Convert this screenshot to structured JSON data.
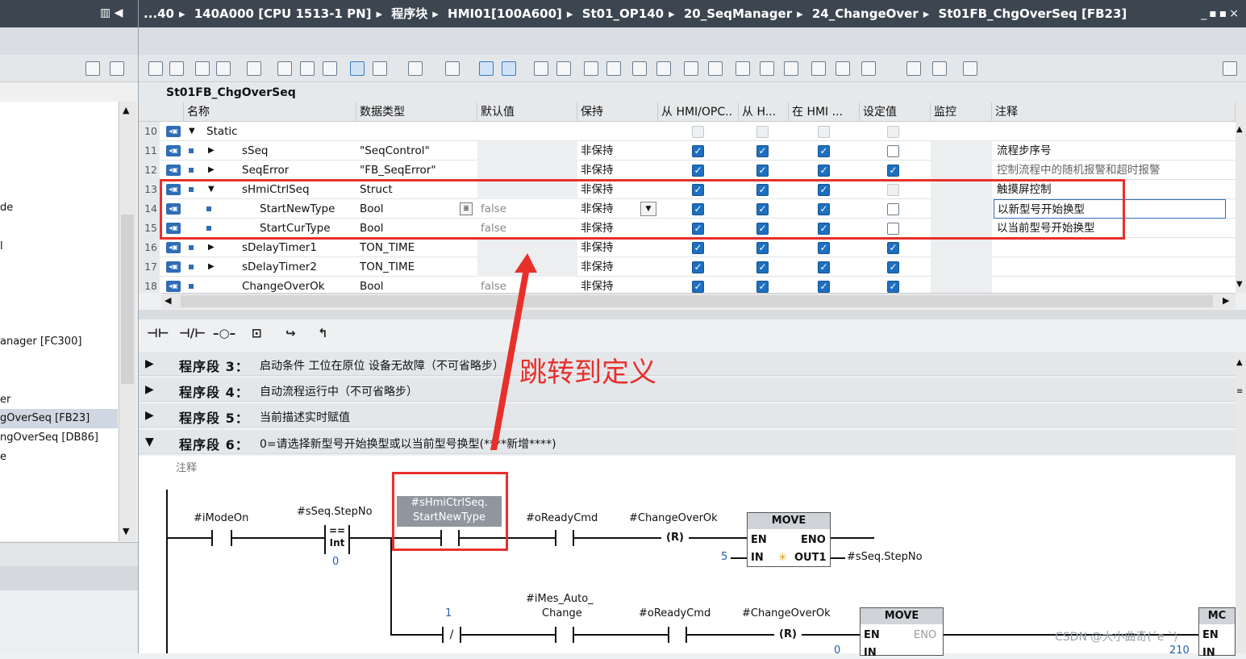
{
  "breadcrumb": [
    "...40",
    "140A000 [CPU 1513-1 PN]",
    "程序块",
    "HMI01[100A600]",
    "St01_OP140",
    "20_SeqManager",
    "24_ChangeOver",
    "St01FB_ChgOverSeq [FB23]"
  ],
  "window_controls": "_▪▪×",
  "block_title": "St01FB_ChgOverSeq",
  "left_tree": [
    {
      "text": "de"
    },
    {
      "text": "l"
    },
    {
      "text": "anager [FC300]"
    },
    {
      "text": "er"
    },
    {
      "text": "gOverSeq [FB23]"
    },
    {
      "text": "ngOverSeq [DB86]"
    },
    {
      "text": "e"
    }
  ],
  "columns": [
    "名称",
    "数据类型",
    "默认值",
    "保持",
    "从 HMI/OPC..",
    "从 H...",
    "在 HMI ...",
    "设定值",
    "监控",
    "注释"
  ],
  "rows": [
    {
      "n": "10",
      "name": "Static",
      "type": "",
      "def": "",
      "ret": "",
      "c": [
        0,
        0,
        0,
        0
      ],
      "comment": "",
      "static": true
    },
    {
      "n": "11",
      "name": "sSeq",
      "type": "\"SeqControl\"",
      "def": "",
      "ret": "非保持",
      "c": [
        1,
        1,
        1,
        0
      ],
      "comment": "流程步序号"
    },
    {
      "n": "12",
      "name": "SeqError",
      "type": "\"FB_SeqError\"",
      "def": "",
      "ret": "非保持",
      "c": [
        1,
        1,
        1,
        1
      ],
      "comment": "控制流程中的随机报警和超时报警"
    },
    {
      "n": "13",
      "name": "sHmiCtrlSeq",
      "type": "Struct",
      "def": "",
      "ret": "非保持",
      "c": [
        1,
        1,
        1,
        0
      ],
      "comment": "触摸屏控制"
    },
    {
      "n": "14",
      "name": "StartNewType",
      "type": "Bool",
      "def": "false",
      "ret": "非保持",
      "c": [
        1,
        1,
        1,
        0
      ],
      "comment": "以新型号开始换型"
    },
    {
      "n": "15",
      "name": "StartCurType",
      "type": "Bool",
      "def": "false",
      "ret": "非保持",
      "c": [
        1,
        1,
        1,
        0
      ],
      "comment": "以当前型号开始换型"
    },
    {
      "n": "16",
      "name": "sDelayTimer1",
      "type": "TON_TIME",
      "def": "",
      "ret": "非保持",
      "c": [
        1,
        1,
        1,
        1
      ],
      "comment": ""
    },
    {
      "n": "17",
      "name": "sDelayTimer2",
      "type": "TON_TIME",
      "def": "",
      "ret": "非保持",
      "c": [
        1,
        1,
        1,
        1
      ],
      "comment": ""
    },
    {
      "n": "18",
      "name": "ChangeOverOk",
      "type": "Bool",
      "def": "false",
      "ret": "非保持",
      "c": [
        1,
        1,
        1,
        1
      ],
      "comment": ""
    }
  ],
  "segments": [
    {
      "label": "程序段 3：",
      "text": "启动条件 工位在原位 设备无故障（不可省略步）",
      "arrow": "▶"
    },
    {
      "label": "程序段 4：",
      "text": "自动流程运行中（不可省略步）",
      "arrow": "▶"
    },
    {
      "label": "程序段 5：",
      "text": "当前描述实时赋值",
      "arrow": "▶"
    },
    {
      "label": "程序段 6：",
      "text": "0=请选择新型号开始换型或以当前型号换型(****新增****)",
      "arrow": "▼"
    }
  ],
  "annotation": "跳转到定义",
  "lad": {
    "comment_label": "注释",
    "c1": "#iModeOn",
    "c2": "#sSeq.StepNo",
    "cmp_top": "==",
    "cmp_bot": "Int",
    "cmp_val": "0",
    "c3a": "#sHmiCtrlSeq.",
    "c3b": "StartNewType",
    "c4": "#oReadyCmd",
    "c5": "#ChangeOverOk",
    "reset": "R",
    "move": "MOVE",
    "en": "EN",
    "eno": "ENO",
    "in": "IN",
    "out1": "OUT1",
    "in_val": "5",
    "out_var": "#sSeq.StepNo",
    "b1": "1",
    "b2a": "#iMes_Auto_",
    "b2b": "Change",
    "b3": "#oReadyCmd",
    "b4": "#ChangeOverOk",
    "b_in_val": "0",
    "b_in2_val": "210",
    "mc": "MC",
    "watermark": "CSDN @大小曲奇(ˊe ˋ)"
  }
}
